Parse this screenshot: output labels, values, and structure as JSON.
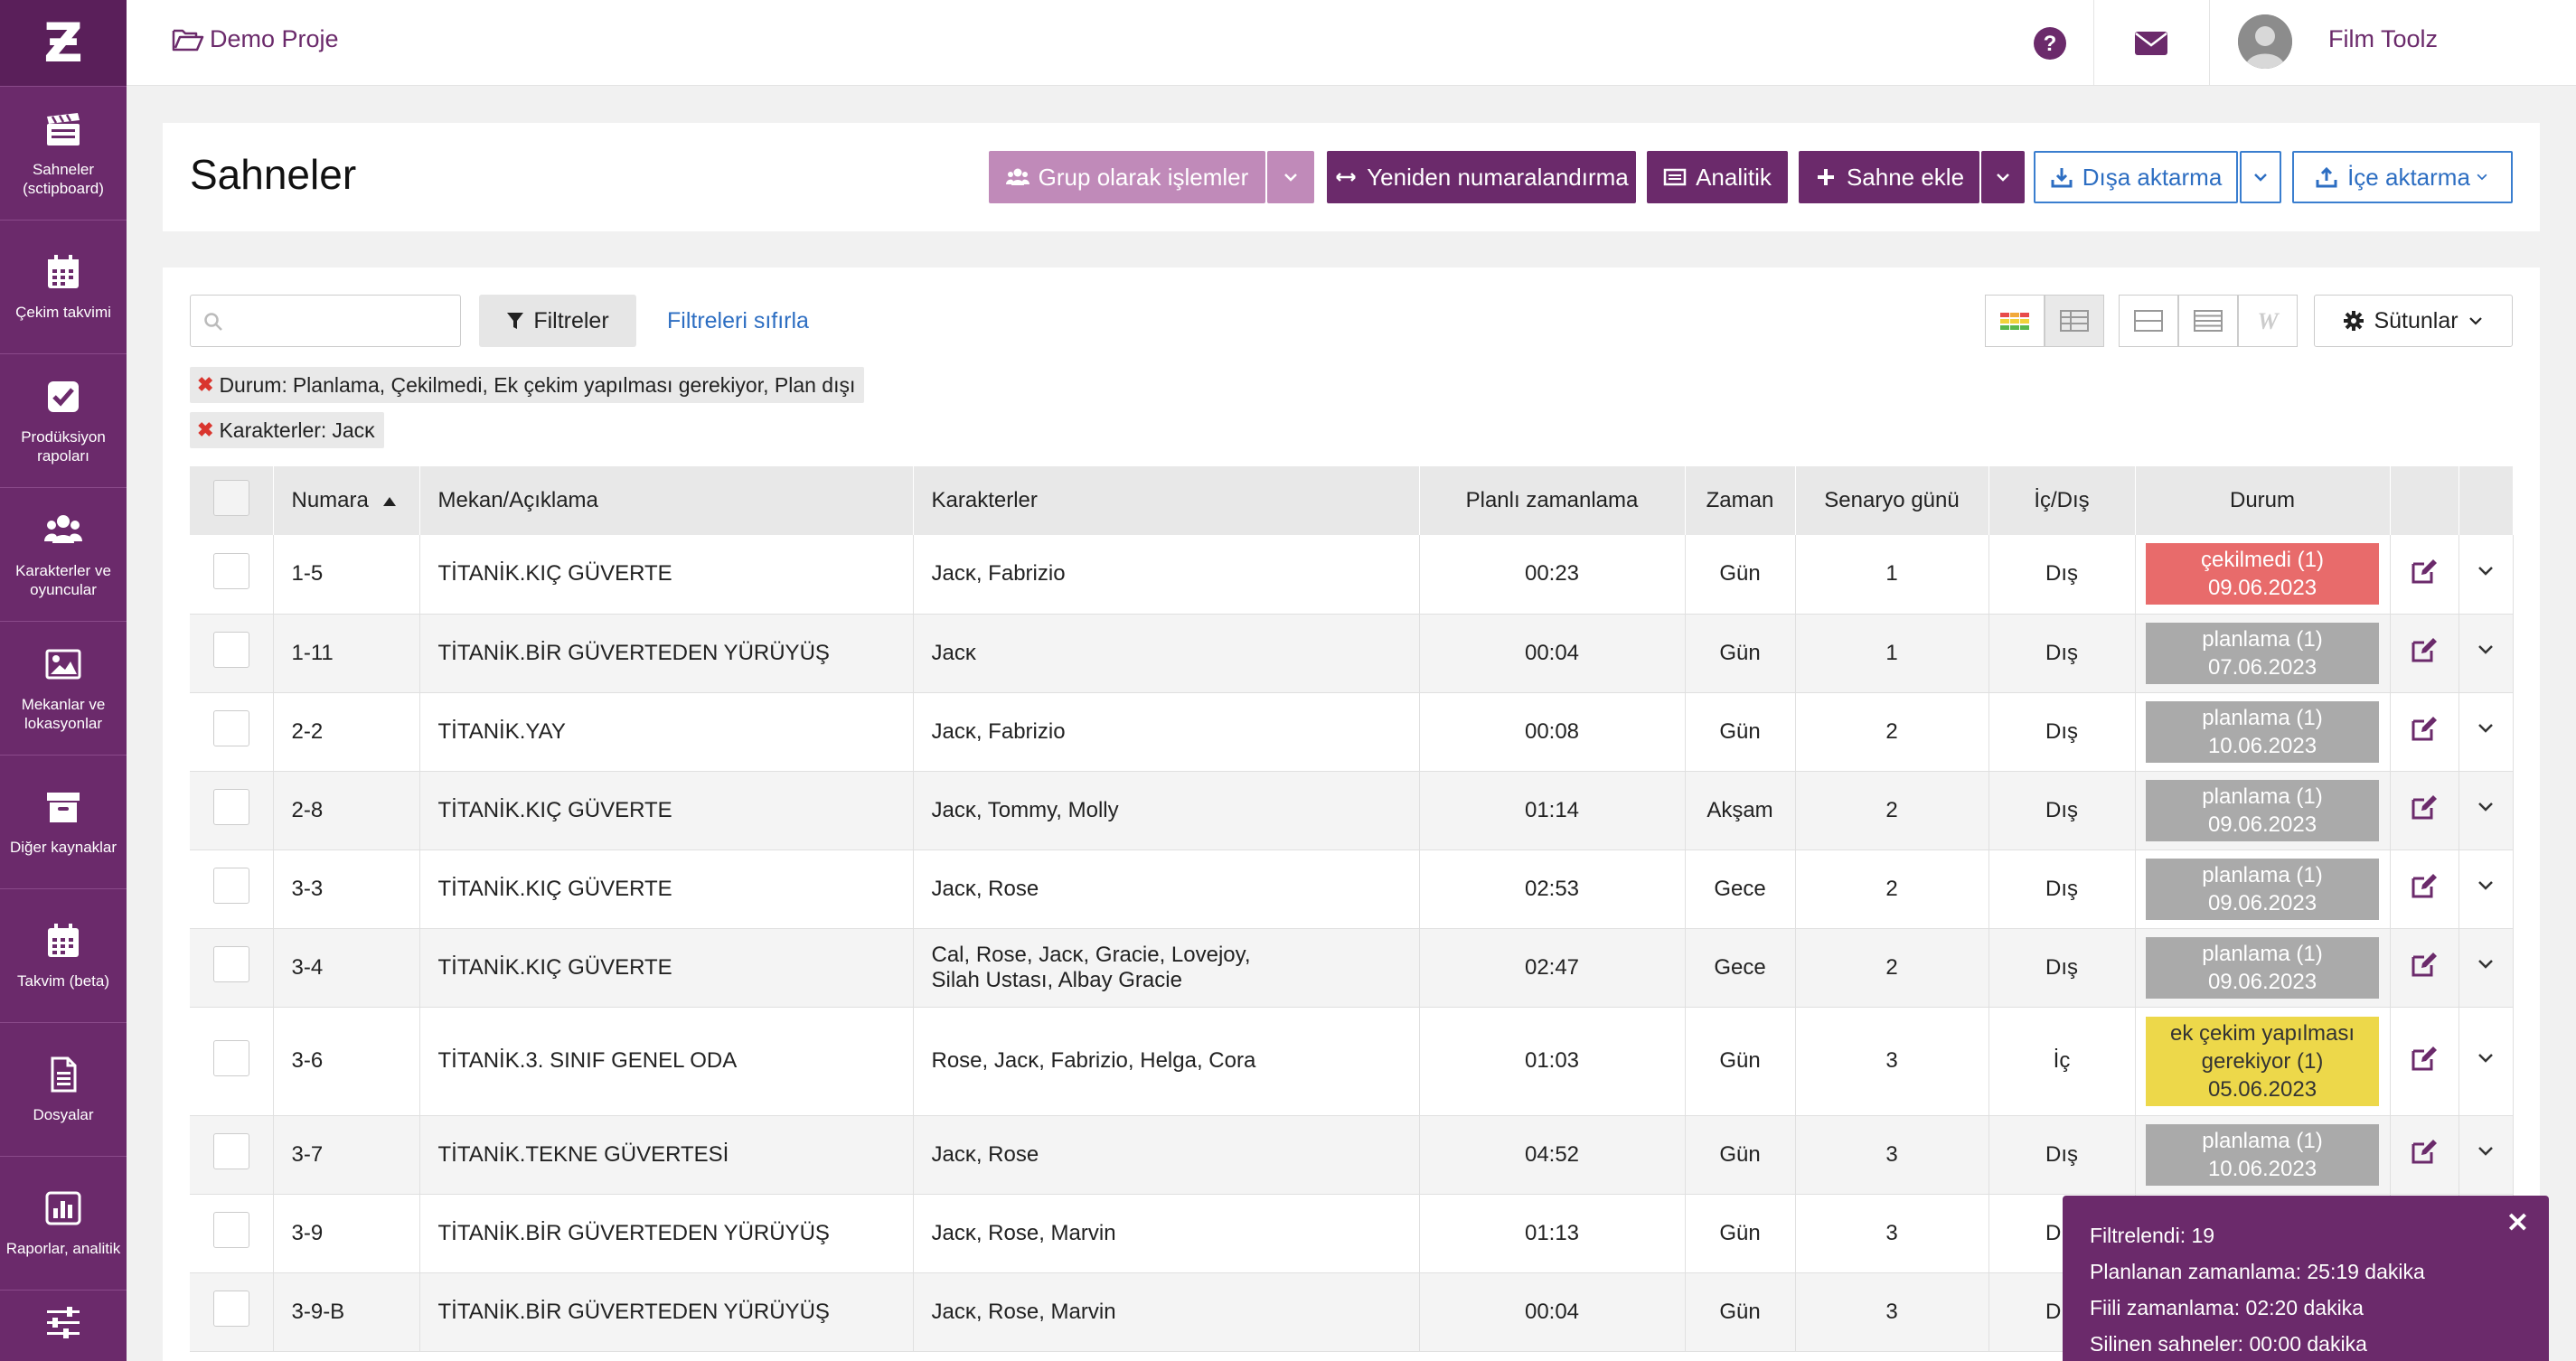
{
  "colors": {
    "primary": "#6b2a6b",
    "accent_pink": "#c08ab9",
    "link": "#2d6ec2",
    "status_red": "#e86b6b",
    "status_gray": "#aaaaaa",
    "status_yellow": "#edd84a"
  },
  "topbar": {
    "project_name": "Demo Proje",
    "user_name": "Film Toolz",
    "language": "TR"
  },
  "sidebar": {
    "items": [
      {
        "label": "Sahneler (sctipboard)",
        "icon": "clapperboard-icon"
      },
      {
        "label": "Çekim takvimi",
        "icon": "calendar-icon"
      },
      {
        "label": "Prodüksiyon rapoları",
        "icon": "checkbox-icon"
      },
      {
        "label": "Karakterler ve oyuncular",
        "icon": "users-icon"
      },
      {
        "label": "Mekanlar ve lokasyonlar",
        "icon": "image-icon"
      },
      {
        "label": "Diğer kaynaklar",
        "icon": "archive-icon"
      },
      {
        "label": "Takvim (beta)",
        "icon": "calendar-icon"
      },
      {
        "label": "Dosyalar",
        "icon": "file-icon"
      },
      {
        "label": "Raporlar, analitik",
        "icon": "bar-chart-icon"
      },
      {
        "label": "",
        "icon": "sliders-icon"
      }
    ]
  },
  "header": {
    "title": "Sahneler",
    "buttons": {
      "group_ops": "Grup olarak işlemler",
      "renumber": "Yeniden numaralandırma",
      "analytics": "Analitik",
      "add_scene": "Sahne ekle",
      "export": "Dışa aktarma",
      "import": "İçe aktarma"
    }
  },
  "toolbar": {
    "search_placeholder": "",
    "filters_label": "Filtreler",
    "reset_filters_label": "Filtreleri sıfırla",
    "columns_label": "Sütunlar"
  },
  "active_filters": [
    {
      "label": "Durum:",
      "value": "Planlama, Çekilmedi, Ek çekim yapılması gerekiyor, Plan dışı"
    },
    {
      "label": "Karakterler:",
      "value": "Jacĸ"
    }
  ],
  "table": {
    "headers": [
      "Numara",
      "Mekan/Açıklama",
      "Karakterler",
      "Planlı zamanlama",
      "Zaman",
      "Senaryo günü",
      "İç/Dış",
      "Durum"
    ],
    "rows": [
      {
        "num": "1-5",
        "place": "TİTANİK.KIÇ GÜVERTE",
        "chars": "Jacĸ, Fabrizio",
        "planned": "00:23",
        "time": "Gün",
        "day": "1",
        "io": "Dış",
        "status": "çekilmedi (1)",
        "date": "09.06.2023",
        "status_color": "red"
      },
      {
        "num": "1-11",
        "place": "TİTANİK.BİR GÜVERTEDEN YÜRÜYÜŞ",
        "chars": "Jacĸ",
        "planned": "00:04",
        "time": "Gün",
        "day": "1",
        "io": "Dış",
        "status": "planlama (1)",
        "date": "07.06.2023",
        "status_color": "gray"
      },
      {
        "num": "2-2",
        "place": "TİTANİK.YAY",
        "chars": "Jacĸ, Fabrizio",
        "planned": "00:08",
        "time": "Gün",
        "day": "2",
        "io": "Dış",
        "status": "planlama (1)",
        "date": "10.06.2023",
        "status_color": "gray"
      },
      {
        "num": "2-8",
        "place": "TİTANİK.KIÇ GÜVERTE",
        "chars": "Jacĸ, Tommy, Molly",
        "planned": "01:14",
        "time": "Akşam",
        "day": "2",
        "io": "Dış",
        "status": "planlama (1)",
        "date": "09.06.2023",
        "status_color": "gray"
      },
      {
        "num": "3-3",
        "place": "TİTANİK.KIÇ GÜVERTE",
        "chars": "Jacĸ, Rose",
        "planned": "02:53",
        "time": "Gece",
        "day": "2",
        "io": "Dış",
        "status": "planlama (1)",
        "date": "09.06.2023",
        "status_color": "gray"
      },
      {
        "num": "3-4",
        "place": "TİTANİK.KIÇ GÜVERTE",
        "chars": "Cal, Rose, Jacĸ, Gracie, Lovejoy, Silah Ustası, Albay Gracie",
        "planned": "02:47",
        "time": "Gece",
        "day": "2",
        "io": "Dış",
        "status": "planlama (1)",
        "date": "09.06.2023",
        "status_color": "gray"
      },
      {
        "num": "3-6",
        "place": "TİTANİK.3. SINIF GENEL ODA",
        "chars": "Rose, Jacĸ, Fabrizio, Helga, Cora",
        "planned": "01:03",
        "time": "Gün",
        "day": "3",
        "io": "İç",
        "status": "ek çekim yapılması gerekiyor (1)",
        "date": "05.06.2023",
        "status_color": "yellow"
      },
      {
        "num": "3-7",
        "place": "TİTANİK.TEKNE GÜVERTESİ",
        "chars": "Jacĸ, Rose",
        "planned": "04:52",
        "time": "Gün",
        "day": "3",
        "io": "Dış",
        "status": "planlama (1)",
        "date": "10.06.2023",
        "status_color": "gray"
      },
      {
        "num": "3-9",
        "place": "TİTANİK.BİR GÜVERTEDEN YÜRÜYÜŞ",
        "chars": "Jacĸ, Rose, Marvin",
        "planned": "01:13",
        "time": "Gün",
        "day": "3",
        "io": "Dış",
        "status": "",
        "date": "",
        "status_color": ""
      },
      {
        "num": "3-9-B",
        "place": "TİTANİK.BİR GÜVERTEDEN YÜRÜYÜŞ",
        "chars": "Jacĸ, Rose, Marvin",
        "planned": "00:04",
        "time": "Gün",
        "day": "3",
        "io": "Dış",
        "status": "",
        "date": "",
        "status_color": ""
      }
    ]
  },
  "summary": {
    "filtered": "Filtrelendi: 19",
    "planned": "Planlanan zamanlama: 25:19 dakika",
    "actual": "Fiili zamanlama: 02:20 dakika",
    "deleted": "Silinen sahneler: 00:00 dakika"
  }
}
